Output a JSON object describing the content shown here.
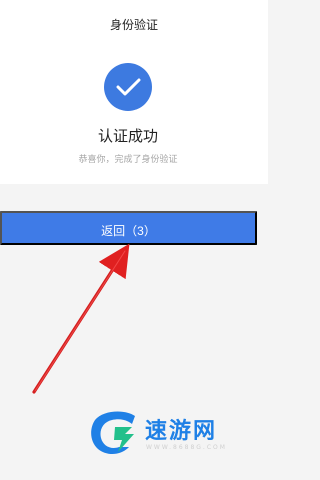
{
  "header": {
    "title": "身份验证"
  },
  "verification": {
    "status_icon": "check-circle-icon",
    "title": "认证成功",
    "subtitle": "恭喜你，完成了身份验证"
  },
  "actions": {
    "return_label": "返回（3）"
  },
  "watermark": {
    "brand_name": "速游网",
    "url": "WWW.8688G.COM"
  },
  "colors": {
    "accent_blue": "#3f7be7",
    "icon_blue": "#3d7ae0",
    "arrow_red": "#e02020",
    "watermark_blue": "#1f80e6",
    "watermark_green": "#22c08b"
  }
}
